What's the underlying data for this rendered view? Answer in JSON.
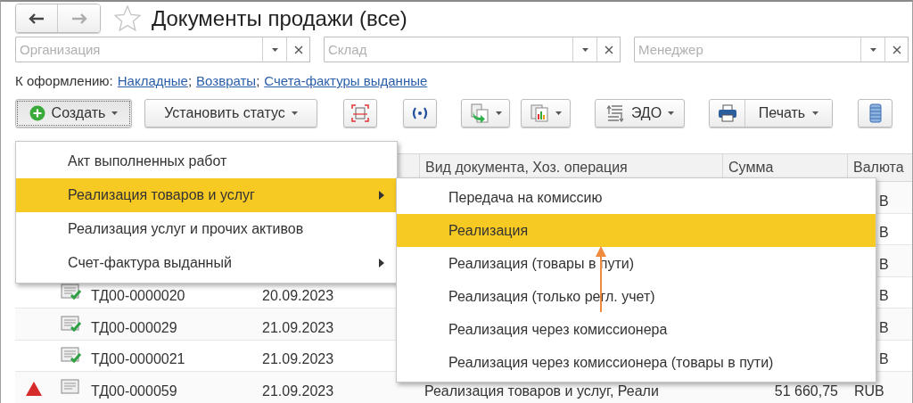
{
  "title": "Документы продажи (все)",
  "filters": [
    {
      "placeholder": "Организация"
    },
    {
      "placeholder": "Склад"
    },
    {
      "placeholder": "Менеджер"
    }
  ],
  "links": {
    "label": "К оформлению:",
    "items": [
      {
        "text": "Накладные",
        "separator": ";"
      },
      {
        "text": "Возвраты",
        "separator": ";"
      },
      {
        "text": "Счета-фактуры выданные"
      }
    ]
  },
  "toolbar": {
    "create_button": {
      "label": "Создать"
    },
    "status_button": {
      "label": "Установить статус"
    },
    "edo_button": {
      "label": "ЭДО"
    },
    "print_button": {
      "label": "Печать"
    }
  },
  "table": {
    "columns": [
      {
        "label": "Вид документа, Хоз. операция"
      },
      {
        "label": "Сумма"
      },
      {
        "label": "Валюта"
      }
    ],
    "rows": [
      {
        "currency": "B"
      },
      {
        "currency": "B"
      },
      {
        "currency": "B"
      },
      {
        "number": "ТД00-0000020",
        "date": "20.09.2023",
        "posted": true,
        "warning": false,
        "currency": "B"
      },
      {
        "number": "ТД00-000029",
        "date": "21.09.2023",
        "posted": true,
        "warning": false,
        "currency": "B"
      },
      {
        "number": "ТД00-0000021",
        "date": "21.09.2023",
        "posted": true,
        "warning": false,
        "currency": "B"
      },
      {
        "number": "ТД00-000059",
        "date": "21.09.2023",
        "posted": false,
        "warning": true,
        "operation": "Реализация товаров и услуг, Реали",
        "sum": "51 660,75",
        "currency": "RUB"
      }
    ]
  },
  "create_menu": {
    "items": [
      {
        "label": "Акт выполненных работ",
        "selected": false,
        "has_submenu": false
      },
      {
        "label": "Реализация товаров и услуг",
        "selected": true,
        "has_submenu": true
      },
      {
        "label": "Реализация услуг и прочих активов",
        "selected": false,
        "has_submenu": false
      },
      {
        "label": "Счет-фактура выданный",
        "selected": false,
        "has_submenu": true
      }
    ]
  },
  "submenu": {
    "items": [
      {
        "label": "Передача на комиссию",
        "selected": false
      },
      {
        "label": "Реализация",
        "selected": true
      },
      {
        "label": "Реализация (товары в пути)",
        "selected": false
      },
      {
        "label": "Реализация (только регл. учет)",
        "selected": false
      },
      {
        "label": "Реализация через комиссионера",
        "selected": false
      },
      {
        "label": "Реализация через комиссионера (товары в пути)",
        "selected": false
      }
    ]
  }
}
